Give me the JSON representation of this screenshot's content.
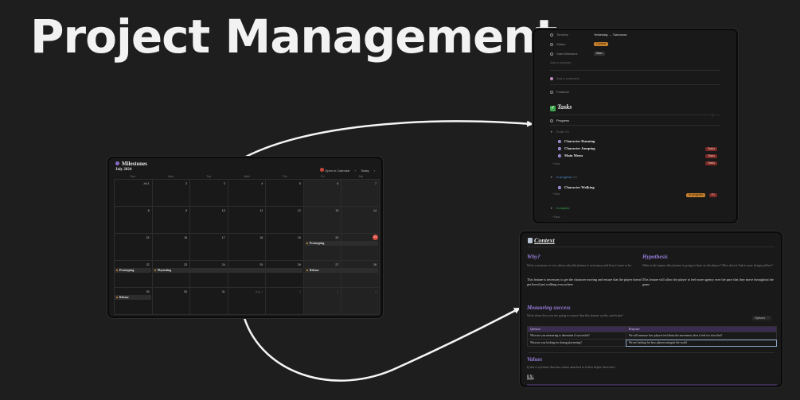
{
  "page": {
    "title": "Project Management"
  },
  "calendar": {
    "heading": "Milestones",
    "month": "July 2024",
    "open_label": "Open in Calendar",
    "today_label": "Today",
    "prev": "‹",
    "next": "›",
    "dows": [
      "Sun",
      "Mon",
      "Tue",
      "Wed",
      "Thu",
      "Fri",
      "Sat"
    ],
    "weeks": [
      [
        "Jul 1",
        "2",
        "3",
        "4",
        "5",
        "6",
        "7"
      ],
      [
        "8",
        "9",
        "10",
        "11",
        "12",
        "13",
        "14"
      ],
      [
        "15",
        "16",
        "17",
        "18",
        "19",
        "20",
        "21"
      ],
      [
        "22",
        "23",
        "24",
        "25",
        "26",
        "27",
        "28"
      ],
      [
        "29",
        "30",
        "31",
        "Aug 1",
        "2",
        "3",
        "4"
      ]
    ],
    "events": {
      "prototyping_1": "Prototyping",
      "prototyping_2": "Prototyping",
      "playtesting": "Playtesting",
      "release_1": "Release",
      "release_2": "Release"
    }
  },
  "tasks": {
    "props": {
      "timeline_label": "Timeline",
      "timeline_value": "Yesterday → Tomorrow",
      "status_label": "Status",
      "status_value": "Current",
      "start_label": "Start Milestone",
      "start_value": "Start",
      "add_prop": "Add a property",
      "comment": "Add a comment...",
      "features": "Features"
    },
    "title": "Tasks",
    "progress": "Progress",
    "groups": {
      "todo_label": "To-do",
      "todo_count": "3/5",
      "inprog_label": "In progress",
      "inprog_count": "0/5",
      "complete_label": "Complete"
    },
    "items": [
      {
        "name": "Character Running",
        "tag": "Tasks"
      },
      {
        "name": "Character Jumping",
        "tag": "Tasks"
      },
      {
        "name": "Main Menu",
        "tag": "Tasks"
      }
    ],
    "inprog_item": {
      "name": "Character Walking",
      "tag1": "In progress",
      "tag2": "P1"
    },
    "new_label": "+ New"
  },
  "context": {
    "title": "Context",
    "why": {
      "heading": "Why?",
      "prompt": "Write a sentence or two about why this feature is necessary and how it came to be.",
      "body": "This feature is necessary to get the character moving and ensure that the player doesn't get bored just walking everywhere"
    },
    "hypothesis": {
      "heading": "Hypothesis",
      "prompt": "What is the impact this feature is going to have on the player? How does it link to your design pillars?",
      "body": "This feature will allow the player to feel more agency over the pace that they move throughout the game"
    },
    "measuring": {
      "heading": "Measuring success",
      "prompt": "Write down how you are going to ensure that this feature works, and is fun!"
    },
    "options": "Options",
    "table": {
      "headers": [
        "Question",
        "Response"
      ],
      "rows": [
        [
          "What are you measuring to determine if successful?",
          "We will measure how players feel about the movement, does it feel too slow/fast?"
        ],
        [
          "What are you looking for during playtesting?",
          "We are looking for how players navigate the world"
        ]
      ]
    },
    "values": {
      "heading": "Values",
      "prompt": "If this is a feature that has values attached to it then define them here."
    },
    "ex": "EX:"
  }
}
